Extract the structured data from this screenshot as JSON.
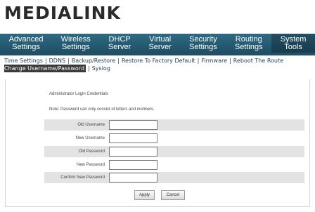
{
  "brand": {
    "logo_text": "MEDIALINK"
  },
  "main_nav": [
    {
      "line1": "Advanced",
      "line2": "Settings"
    },
    {
      "line1": "Wireless",
      "line2": "Settings"
    },
    {
      "line1": "DHCP",
      "line2": "Server"
    },
    {
      "line1": "Virtual",
      "line2": "Server"
    },
    {
      "line1": "Security",
      "line2": "Settings"
    },
    {
      "line1": "Routing",
      "line2": "Settings"
    },
    {
      "line1": "System",
      "line2": "Tools"
    }
  ],
  "active_main_nav": "System Tools",
  "sub_nav": [
    "Time Settings",
    "DDNS",
    "Backup/Restore",
    "Restore To Factory Default",
    "Firmware",
    "Reboot The Route",
    "Change Username/Password",
    "Syslog"
  ],
  "active_sub_nav": "Change Username/Password",
  "form": {
    "heading": "Administrator Login Credentials",
    "note": "Note: Password can only consist of letters and numbers.",
    "fields": [
      {
        "label": "Old Username",
        "value": ""
      },
      {
        "label": "New Username",
        "value": ""
      },
      {
        "label": "Old Password",
        "value": ""
      },
      {
        "label": "New Password",
        "value": ""
      },
      {
        "label": "Confirm New Password",
        "value": ""
      }
    ],
    "apply_label": "Apply",
    "cancel_label": "Cancel"
  },
  "colors": {
    "nav_background": "#1f5066",
    "nav_text": "#ffffff",
    "submenu_text": "#1c3c5a",
    "shaded_row": "#e3e3e3"
  }
}
